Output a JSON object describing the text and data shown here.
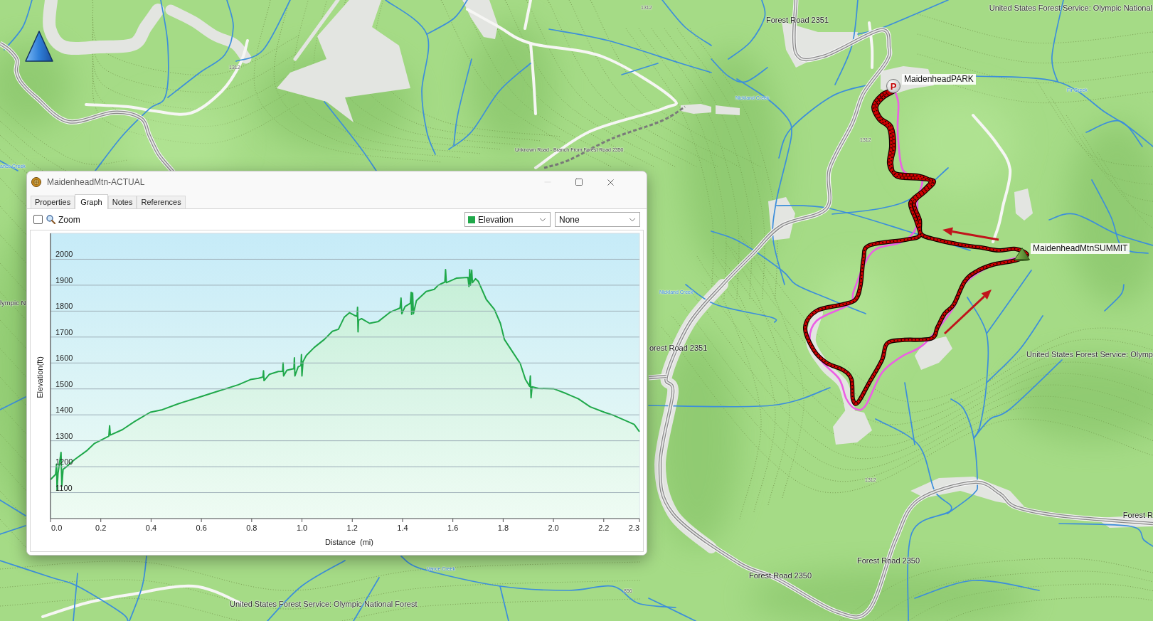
{
  "map": {
    "labels": [
      {
        "kind": "spot",
        "text": "1312"
      },
      {
        "kind": "area",
        "text": "United States Forest Service: Olympic National"
      },
      {
        "kind": "road",
        "text": "Forest Road 2351"
      },
      {
        "kind": "spot",
        "text": "1312"
      },
      {
        "kind": "creek",
        "text": "Fir Creek"
      },
      {
        "kind": "creek",
        "text": "Nickland Creek"
      },
      {
        "kind": "spot",
        "text": "1312"
      },
      {
        "kind": "minor_road",
        "text": "Unknown Road - Branch From Forest Road 2350"
      },
      {
        "kind": "creek",
        "text": "ance Creek"
      },
      {
        "kind": "creek",
        "text": "Nickland Creek"
      },
      {
        "kind": "area",
        "text": "lympic N"
      },
      {
        "kind": "road",
        "text": "orest Road 2351"
      },
      {
        "kind": "area",
        "text": "United States Forest Service: Olymp"
      },
      {
        "kind": "spot",
        "text": "1312"
      },
      {
        "kind": "road",
        "text": "Forest R"
      },
      {
        "kind": "road",
        "text": "Forest Road 2350"
      },
      {
        "kind": "creek",
        "text": "Vance Creek"
      },
      {
        "kind": "road",
        "text": "Forest Road 2350"
      },
      {
        "kind": "spot",
        "text": "856"
      },
      {
        "kind": "area",
        "text": "United States Forest Service: Olympic National Forest"
      }
    ],
    "waypoints": [
      {
        "kind": "parking",
        "symbol": "P",
        "label": "MaidenheadPARK"
      },
      {
        "kind": "summit",
        "label": "MaidenheadMtnSUMMIT"
      }
    ]
  },
  "window": {
    "title": "MaidenheadMtn-ACTUAL",
    "controls": [
      {
        "kind": "minimize",
        "disabled": true
      },
      {
        "kind": "maximize",
        "disabled": false
      },
      {
        "kind": "close",
        "disabled": false
      }
    ]
  },
  "tabs": [
    {
      "label": "Properties",
      "selected": false
    },
    {
      "label": "Graph",
      "selected": true
    },
    {
      "label": "Notes",
      "selected": false
    },
    {
      "label": "References",
      "selected": false
    }
  ],
  "graph": {
    "zoom": {
      "label": "Zoom",
      "checked": false
    },
    "compare_dropdown": {
      "value": "None"
    },
    "chart_data": {
      "type": "area",
      "grid": true,
      "xlabel": "Distance  (mi)",
      "ylabel": "Elevation(ft)",
      "x": [
        0,
        0.02,
        0.024,
        0.026,
        0.03,
        0.042,
        0.045,
        0.05,
        0.064,
        0.095,
        0.143,
        0.175,
        0.232,
        0.235,
        0.238,
        0.286,
        0.334,
        0.397,
        0.445,
        0.509,
        0.588,
        0.652,
        0.747,
        0.795,
        0.827,
        0.845,
        0.847,
        0.849,
        0.87,
        0.906,
        0.923,
        0.925,
        0.927,
        0.94,
        0.968,
        0.97,
        0.972,
        0.985,
        0.996,
        0.998,
        1.0,
        1.004,
        1.017,
        1.049,
        1.089,
        1.121,
        1.145,
        1.168,
        1.189,
        1.208,
        1.219,
        1.221,
        1.223,
        1.225,
        1.237,
        1.269,
        1.304,
        1.351,
        1.39,
        1.394,
        1.397,
        1.41,
        1.431,
        1.434,
        1.436,
        1.44,
        1.443,
        1.455,
        1.494,
        1.526,
        1.542,
        1.568,
        1.571,
        1.574,
        1.614,
        1.66,
        1.664,
        1.667,
        1.67,
        1.675,
        1.678,
        1.69,
        1.701,
        1.733,
        1.765,
        1.789,
        1.805,
        1.836,
        1.868,
        1.889,
        1.905,
        1.908,
        1.911,
        1.915,
        1.94,
        2.0,
        2.051,
        2.099,
        2.146,
        2.202,
        2.242,
        2.289,
        2.321,
        2.342
      ],
      "series": [
        {
          "name": "Elevation",
          "color": "#1fa84a",
          "values": [
            1150,
            1170,
            1210,
            1110,
            1175,
            1255,
            1125,
            1190,
            1200,
            1227,
            1261,
            1290,
            1318,
            1358,
            1322,
            1343,
            1374,
            1410,
            1420,
            1443,
            1467,
            1487,
            1516,
            1536,
            1541,
            1546,
            1570,
            1532,
            1556,
            1567,
            1568,
            1600,
            1550,
            1572,
            1578,
            1620,
            1550,
            1585,
            1590,
            1632,
            1550,
            1605,
            1629,
            1660,
            1691,
            1722,
            1730,
            1776,
            1794,
            1784,
            1780,
            1815,
            1720,
            1765,
            1771,
            1753,
            1760,
            1796,
            1812,
            1850,
            1790,
            1818,
            1830,
            1872,
            1787,
            1870,
            1790,
            1840,
            1876,
            1884,
            1900,
            1912,
            1960,
            1910,
            1927,
            1930,
            1895,
            1960,
            1900,
            1958,
            1910,
            1925,
            1915,
            1845,
            1807,
            1753,
            1691,
            1645,
            1598,
            1536,
            1510,
            1550,
            1466,
            1508,
            1502,
            1501,
            1482,
            1462,
            1431,
            1410,
            1397,
            1377,
            1363,
            1335
          ]
        }
      ],
      "xlim": [
        0,
        2.342
      ],
      "ylim": [
        1000,
        2100
      ],
      "xticks": [
        {
          "value": 0,
          "label": "0.0"
        },
        0.2,
        0.4,
        0.6,
        0.8,
        {
          "value": 1,
          "label": "1.0"
        },
        1.2,
        1.4,
        1.6,
        1.8,
        {
          "value": 2,
          "label": "2.0"
        },
        2.2,
        {
          "value": 2.342,
          "label": "2.3"
        }
      ],
      "yticks": [
        1100,
        1200,
        1300,
        1400,
        1500,
        1600,
        1700,
        1800,
        1900,
        2000
      ]
    }
  }
}
